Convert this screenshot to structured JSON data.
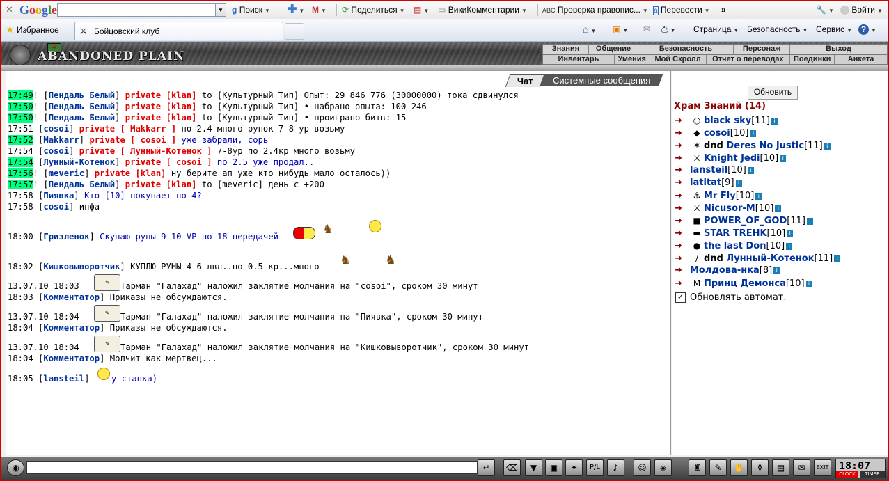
{
  "google_toolbar": {
    "brand": "Google",
    "search_value": "",
    "search_button": "Поиск",
    "share": "Поделиться",
    "wiki": "ВикиКомментарии",
    "spell": "Проверка правопис...",
    "translate": "Перевести",
    "more": "»",
    "signin": "Войти"
  },
  "ie_bar": {
    "favorites": "Избранное",
    "tab_title": "Бойцовский клуб",
    "page": "Страница",
    "safety": "Безопасность",
    "service": "Сервис",
    "help": "?"
  },
  "game_header": {
    "logo": "ABANDONED PLAIN",
    "menu_top": [
      "Знания",
      "Общение",
      "Безопасность",
      "Персонаж",
      "Выход"
    ],
    "menu_bottom": [
      "Инвентарь",
      "Умения",
      "Мой Скролл",
      "Отчет о переводах",
      "Поединки",
      "Анкета"
    ]
  },
  "chat": {
    "tabs": {
      "chat": "Чат",
      "system": "Системные сообщения"
    },
    "lines": [
      {
        "time": "17:49",
        "hl": true,
        "sep": "! [",
        "name": "Пендаль Белый",
        "close": "]",
        "priv": "private [klan]",
        "text": " to [Культурный Тип] Опыт: 29 846 776 (30000000) тока сдвинулся",
        "blue": false
      },
      {
        "time": "17:50",
        "hl": true,
        "sep": "! [",
        "name": "Пендаль Белый",
        "close": "]",
        "priv": "private [klan]",
        "text": " to [Культурный Тип] • набрано опыта: 100 246",
        "blue": false
      },
      {
        "time": "17:50",
        "hl": true,
        "sep": "! [",
        "name": "Пендаль Белый",
        "close": "]",
        "priv": "private [klan]",
        "text": " to [Культурный Тип] • проиграно битв: 15",
        "blue": false
      },
      {
        "time": "17:51",
        "hl": false,
        "sep": " [",
        "name": "cosoi",
        "close": "]",
        "priv": "private [ Makkarr ]",
        "text": " по 2.4 много рунок 7-8 ур возьму",
        "blue": false
      },
      {
        "time": "17:52",
        "hl": true,
        "sep": " [",
        "name": "Makkarr",
        "close": "]",
        "priv": "private [ cosoi ]",
        "text": " уже забрали, сорь",
        "blue": true
      },
      {
        "time": "17:54",
        "hl": false,
        "sep": " [",
        "name": "cosoi",
        "close": "]",
        "priv": "private [ Лунный-Котенок ]",
        "text": " 7-8ур по 2.4кр много возьму",
        "blue": false
      },
      {
        "time": "17:54",
        "hl": true,
        "sep": " [",
        "name": "Лунный-Котенок",
        "close": "]",
        "priv": "private [ cosoi ]",
        "text": " по 2.5 уже продал..",
        "blue": true
      },
      {
        "time": "17:56",
        "hl": true,
        "sep": "! [",
        "name": "meveric",
        "close": "]",
        "priv": "private [klan]",
        "text": " ну берите ап уже кто нибудь мало осталось))",
        "blue": false
      },
      {
        "time": "17:57",
        "hl": true,
        "sep": "! [",
        "name": "Пендаль Белый",
        "close": "]",
        "priv": "private [klan]",
        "text": " to [meveric] день с +200",
        "blue": false
      },
      {
        "time": "17:58",
        "hl": false,
        "sep": " [",
        "name": "Пиявка",
        "close": "]",
        "priv": "",
        "text": " Кто [10] покупает по 4?",
        "blue": true
      },
      {
        "time": "17:58",
        "hl": false,
        "sep": " [",
        "name": "cosoi",
        "close": "]",
        "priv": "",
        "text": " инфа",
        "blue": false
      }
    ],
    "line_grizl": {
      "time": "18:00",
      "name": "Гризленок",
      "text": "Скупаю руны 9-10 VP по 18 передачей"
    },
    "line_kish": {
      "time": "18:02",
      "name": "Кишковыворотчик",
      "text": "КУПЛЮ РУНЫ 4-6 лвл..по 0.5 кр...много"
    },
    "system": [
      {
        "date": "13.07.10 18:03",
        "text": "Тарман \"Галахад\" наложил заклятие молчания на \"cosoi\", сроком 30 минут",
        "ctime": "18:03",
        "cname": "Комментатор",
        "ctext": "Приказы не обсуждаются."
      },
      {
        "date": "13.07.10 18:04",
        "text": "Тарман \"Галахад\" наложил заклятие молчания на \"Пиявка\", сроком 30 минут",
        "ctime": "18:04",
        "cname": "Комментатор",
        "ctext": "Приказы не обсуждаются."
      },
      {
        "date": "13.07.10 18:04",
        "text": "Тарман \"Галахад\" наложил заклятие молчания на \"Кишковыворотчик\", сроком 30 минут",
        "ctime": "18:04",
        "cname": "Комментатор",
        "ctext": "Молчит как мертвец..."
      }
    ],
    "line_last": {
      "time": "18:05",
      "name": "lansteil",
      "text": "у станка)"
    }
  },
  "room": {
    "refresh": "Обновить",
    "title": "Храм Знаний (14)",
    "users": [
      {
        "dnd": "",
        "name": "black sky",
        "level": "[11]",
        "icon": "○"
      },
      {
        "dnd": "",
        "name": "cosoi",
        "level": "[10]",
        "icon": "◆"
      },
      {
        "dnd": "dnd",
        "name": "Deres No Justic",
        "level": "[11]",
        "icon": "✶"
      },
      {
        "dnd": "",
        "name": "Knight Jedi",
        "level": "[10]",
        "icon": "⚔"
      },
      {
        "dnd": "",
        "name": "lansteil",
        "level": "[10]",
        "icon": ""
      },
      {
        "dnd": "",
        "name": "latitat",
        "level": "[9]",
        "icon": ""
      },
      {
        "dnd": "",
        "name": "Mr Fly",
        "level": "[10]",
        "icon": "⚓"
      },
      {
        "dnd": "",
        "name": "Nicusor-M",
        "level": "[10]",
        "icon": "⚔"
      },
      {
        "dnd": "",
        "name": "POWER_OF_GOD",
        "level": "[11]",
        "icon": "■"
      },
      {
        "dnd": "",
        "name": "STAR TREHK",
        "level": "[10]",
        "icon": "▬"
      },
      {
        "dnd": "",
        "name": "the last Don",
        "level": "[10]",
        "icon": "●"
      },
      {
        "dnd": "dnd",
        "name": "Лунный-Котенок",
        "level": "[11]",
        "icon": "∕"
      },
      {
        "dnd": "",
        "name": "Молдова-нка",
        "level": "[8]",
        "icon": ""
      },
      {
        "dnd": "",
        "name": "Принц Демонса",
        "level": "[10]",
        "icon": "M"
      }
    ],
    "auto_refresh": "Обновлять автомат."
  },
  "bottom": {
    "clock": "18:07",
    "clock_label": "CLOCK",
    "timer_label": "TIMER"
  }
}
